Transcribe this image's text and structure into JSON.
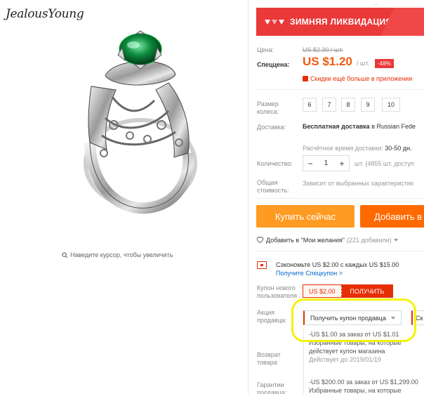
{
  "brand": {
    "logo_text": "JealousYoung"
  },
  "image": {
    "zoom_hint": "Наведите курсор, чтобы увеличить"
  },
  "top_cut_text": "...",
  "promo": {
    "title": "ЗИМНЯЯ ЛИКВИДАЦИЯ",
    "accent_color": "#ea3939"
  },
  "price": {
    "label": "Цена:",
    "old_value": "US $2.30 / шт.",
    "sale_label": "Спеццена:",
    "sale_value": "US $1.20",
    "unit": "/ шт.",
    "discount": "-48%",
    "more_discount": "Скидки ещё больше в приложении"
  },
  "size": {
    "label": "Размер колеса:",
    "options": [
      "6",
      "7",
      "8",
      "9",
      "10"
    ]
  },
  "shipping": {
    "label": "Доставка:",
    "text_bold": "Бесплатная доставка",
    "text_rest": " в Russian Fede",
    "time_label": "Расчётное время доставки:",
    "time_value": " 30-50 дн."
  },
  "quantity": {
    "label": "Количество:",
    "minus": "−",
    "value": "1",
    "plus": "+",
    "stock": "шт. (4855 шт. доступ"
  },
  "total": {
    "label": "Общая стоимость:",
    "text": "Зависит от выбранных характеристик"
  },
  "actions": {
    "buy_now": "Купить сейчас",
    "add_to_cart": "Добавить в"
  },
  "wishlist": {
    "text": "Добавить в \"Мои желания\"",
    "count": "(221 добавили)"
  },
  "coupon": {
    "save_text": "Сэкономьте US $2.00 с каждых US $15.00",
    "save_link": "Получите Спецкупон >",
    "new_user_label": "Купон нового пользователя :",
    "new_user_amount": "US $2.00",
    "get_button": "ПОЛУЧИТЬ"
  },
  "seller": {
    "label": "Акция продавца:",
    "select_value": "Получить купон продавца",
    "second_select": "Ск"
  },
  "offers": {
    "return_label": "Возврат товара",
    "guarantee_label": "Гарантии продавца:",
    "offer1_title": "-US $1.00 за заказ от US $1.01",
    "offer1_desc": "Избранные товары, на которые действует купон магазина",
    "offer1_date": "Действует до 2019/01/19",
    "offer2_title": "-US $200.00 за заказ от US $1,299.00",
    "offer2_desc": "Избранные товары, на которые"
  }
}
